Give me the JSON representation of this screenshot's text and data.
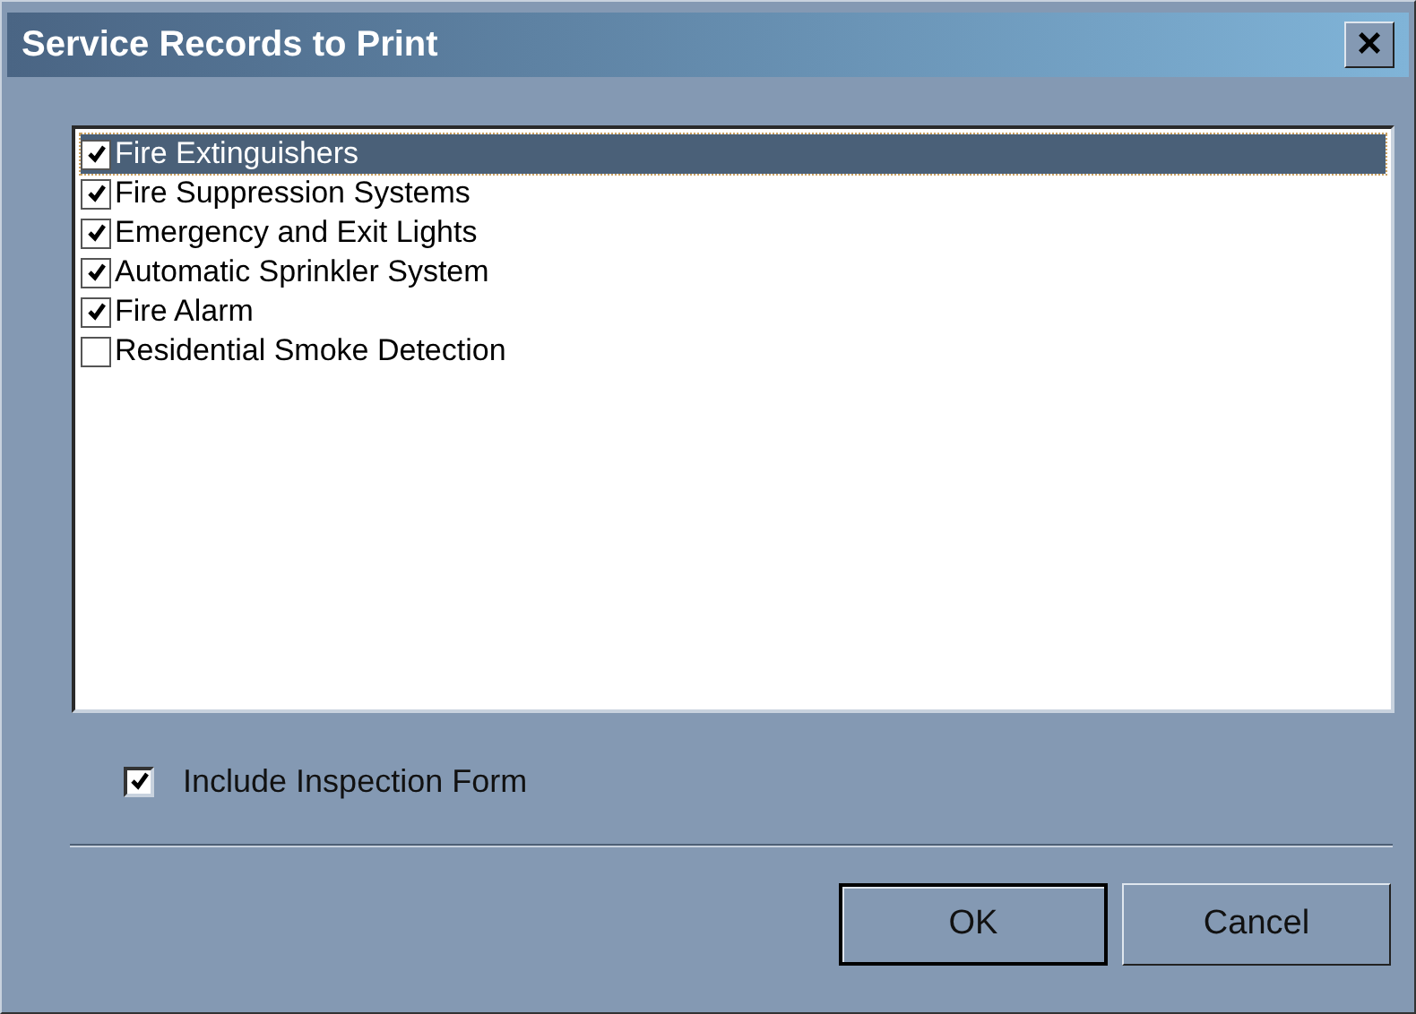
{
  "window": {
    "title": "Service Records to Print",
    "close_label": "×"
  },
  "records": [
    {
      "label": "Fire Extinguishers",
      "checked": true,
      "selected": true
    },
    {
      "label": "Fire Suppression Systems",
      "checked": true,
      "selected": false
    },
    {
      "label": "Emergency and Exit Lights",
      "checked": true,
      "selected": false
    },
    {
      "label": "Automatic Sprinkler System",
      "checked": true,
      "selected": false
    },
    {
      "label": "Fire Alarm",
      "checked": true,
      "selected": false
    },
    {
      "label": "Residential Smoke Detection",
      "checked": false,
      "selected": false
    }
  ],
  "include_form": {
    "label": "Include Inspection Form",
    "checked": true
  },
  "buttons": [
    {
      "label": "OK",
      "default": true
    },
    {
      "label": "Cancel",
      "default": false
    }
  ]
}
